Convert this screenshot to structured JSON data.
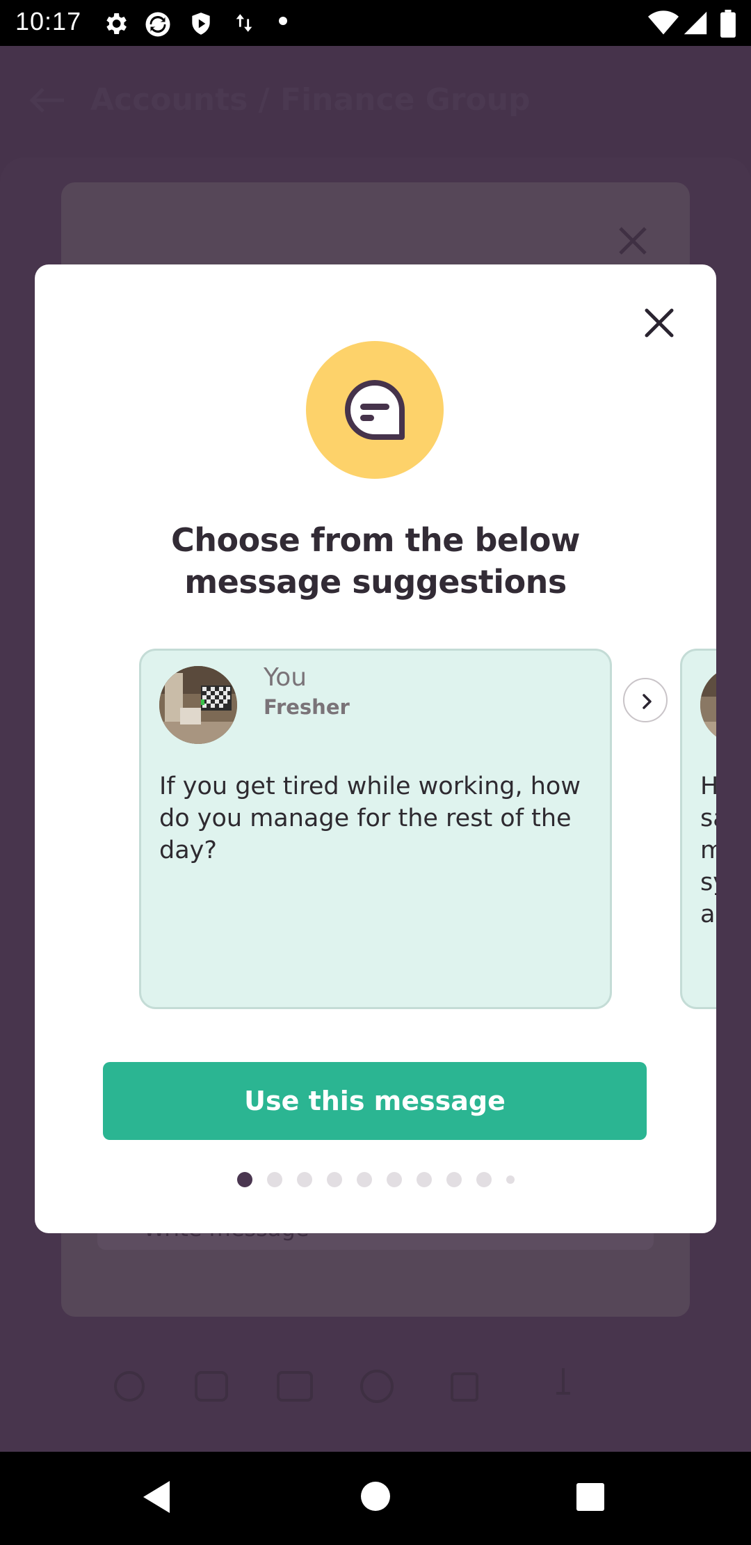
{
  "status_bar": {
    "time": "10:17",
    "icons": [
      "gear-icon",
      "sync-icon",
      "shield-icon",
      "data-transfer-icon",
      "dot-icon",
      "wifi-icon",
      "signal-icon",
      "battery-icon"
    ]
  },
  "background": {
    "title": "Accounts / Finance Group",
    "field_text": "Write message"
  },
  "modal": {
    "icon": "chat-bubble-icon",
    "title": "Choose from the below message suggestions",
    "close_icon": "close-icon",
    "cards": [
      {
        "sender": "You",
        "role": "Fresher",
        "message": "If you get tired while working, how do you manage for the rest of the day?"
      },
      {
        "sender": "",
        "role": "",
        "message": "H\nsa\nm\nsy\na"
      }
    ],
    "next_icon": "chevron-right-icon",
    "button_label": "Use this message",
    "pager": {
      "total": 10,
      "active": 0
    }
  },
  "colors": {
    "accent": "#2bb592",
    "badge": "#fdd26a",
    "card_bg": "#dff3ee",
    "overlay": "#46334b",
    "dark_text": "#322b35"
  },
  "nav_bar": {
    "icons": [
      "back-icon",
      "home-icon",
      "recents-icon"
    ]
  }
}
